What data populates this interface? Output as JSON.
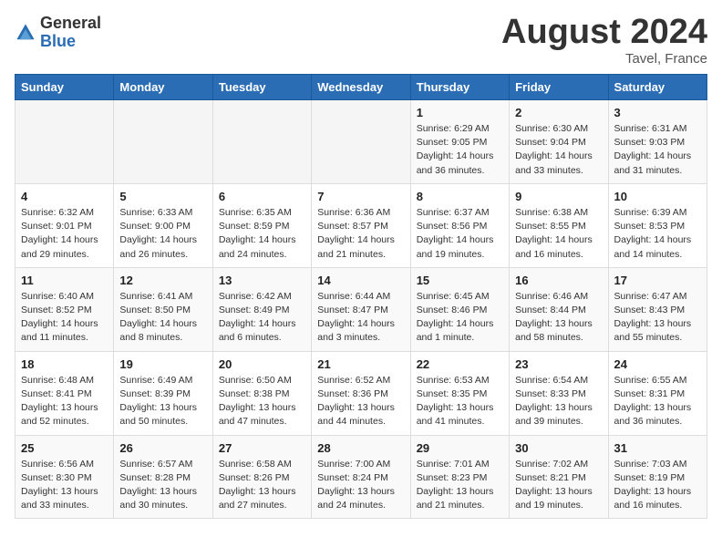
{
  "logo": {
    "general": "General",
    "blue": "Blue"
  },
  "header": {
    "month": "August 2024",
    "location": "Tavel, France"
  },
  "days_of_week": [
    "Sunday",
    "Monday",
    "Tuesday",
    "Wednesday",
    "Thursday",
    "Friday",
    "Saturday"
  ],
  "weeks": [
    [
      {
        "day": "",
        "info": ""
      },
      {
        "day": "",
        "info": ""
      },
      {
        "day": "",
        "info": ""
      },
      {
        "day": "",
        "info": ""
      },
      {
        "day": "1",
        "info": "Sunrise: 6:29 AM\nSunset: 9:05 PM\nDaylight: 14 hours and 36 minutes."
      },
      {
        "day": "2",
        "info": "Sunrise: 6:30 AM\nSunset: 9:04 PM\nDaylight: 14 hours and 33 minutes."
      },
      {
        "day": "3",
        "info": "Sunrise: 6:31 AM\nSunset: 9:03 PM\nDaylight: 14 hours and 31 minutes."
      }
    ],
    [
      {
        "day": "4",
        "info": "Sunrise: 6:32 AM\nSunset: 9:01 PM\nDaylight: 14 hours and 29 minutes."
      },
      {
        "day": "5",
        "info": "Sunrise: 6:33 AM\nSunset: 9:00 PM\nDaylight: 14 hours and 26 minutes."
      },
      {
        "day": "6",
        "info": "Sunrise: 6:35 AM\nSunset: 8:59 PM\nDaylight: 14 hours and 24 minutes."
      },
      {
        "day": "7",
        "info": "Sunrise: 6:36 AM\nSunset: 8:57 PM\nDaylight: 14 hours and 21 minutes."
      },
      {
        "day": "8",
        "info": "Sunrise: 6:37 AM\nSunset: 8:56 PM\nDaylight: 14 hours and 19 minutes."
      },
      {
        "day": "9",
        "info": "Sunrise: 6:38 AM\nSunset: 8:55 PM\nDaylight: 14 hours and 16 minutes."
      },
      {
        "day": "10",
        "info": "Sunrise: 6:39 AM\nSunset: 8:53 PM\nDaylight: 14 hours and 14 minutes."
      }
    ],
    [
      {
        "day": "11",
        "info": "Sunrise: 6:40 AM\nSunset: 8:52 PM\nDaylight: 14 hours and 11 minutes."
      },
      {
        "day": "12",
        "info": "Sunrise: 6:41 AM\nSunset: 8:50 PM\nDaylight: 14 hours and 8 minutes."
      },
      {
        "day": "13",
        "info": "Sunrise: 6:42 AM\nSunset: 8:49 PM\nDaylight: 14 hours and 6 minutes."
      },
      {
        "day": "14",
        "info": "Sunrise: 6:44 AM\nSunset: 8:47 PM\nDaylight: 14 hours and 3 minutes."
      },
      {
        "day": "15",
        "info": "Sunrise: 6:45 AM\nSunset: 8:46 PM\nDaylight: 14 hours and 1 minute."
      },
      {
        "day": "16",
        "info": "Sunrise: 6:46 AM\nSunset: 8:44 PM\nDaylight: 13 hours and 58 minutes."
      },
      {
        "day": "17",
        "info": "Sunrise: 6:47 AM\nSunset: 8:43 PM\nDaylight: 13 hours and 55 minutes."
      }
    ],
    [
      {
        "day": "18",
        "info": "Sunrise: 6:48 AM\nSunset: 8:41 PM\nDaylight: 13 hours and 52 minutes."
      },
      {
        "day": "19",
        "info": "Sunrise: 6:49 AM\nSunset: 8:39 PM\nDaylight: 13 hours and 50 minutes."
      },
      {
        "day": "20",
        "info": "Sunrise: 6:50 AM\nSunset: 8:38 PM\nDaylight: 13 hours and 47 minutes."
      },
      {
        "day": "21",
        "info": "Sunrise: 6:52 AM\nSunset: 8:36 PM\nDaylight: 13 hours and 44 minutes."
      },
      {
        "day": "22",
        "info": "Sunrise: 6:53 AM\nSunset: 8:35 PM\nDaylight: 13 hours and 41 minutes."
      },
      {
        "day": "23",
        "info": "Sunrise: 6:54 AM\nSunset: 8:33 PM\nDaylight: 13 hours and 39 minutes."
      },
      {
        "day": "24",
        "info": "Sunrise: 6:55 AM\nSunset: 8:31 PM\nDaylight: 13 hours and 36 minutes."
      }
    ],
    [
      {
        "day": "25",
        "info": "Sunrise: 6:56 AM\nSunset: 8:30 PM\nDaylight: 13 hours and 33 minutes."
      },
      {
        "day": "26",
        "info": "Sunrise: 6:57 AM\nSunset: 8:28 PM\nDaylight: 13 hours and 30 minutes."
      },
      {
        "day": "27",
        "info": "Sunrise: 6:58 AM\nSunset: 8:26 PM\nDaylight: 13 hours and 27 minutes."
      },
      {
        "day": "28",
        "info": "Sunrise: 7:00 AM\nSunset: 8:24 PM\nDaylight: 13 hours and 24 minutes."
      },
      {
        "day": "29",
        "info": "Sunrise: 7:01 AM\nSunset: 8:23 PM\nDaylight: 13 hours and 21 minutes."
      },
      {
        "day": "30",
        "info": "Sunrise: 7:02 AM\nSunset: 8:21 PM\nDaylight: 13 hours and 19 minutes."
      },
      {
        "day": "31",
        "info": "Sunrise: 7:03 AM\nSunset: 8:19 PM\nDaylight: 13 hours and 16 minutes."
      }
    ]
  ]
}
